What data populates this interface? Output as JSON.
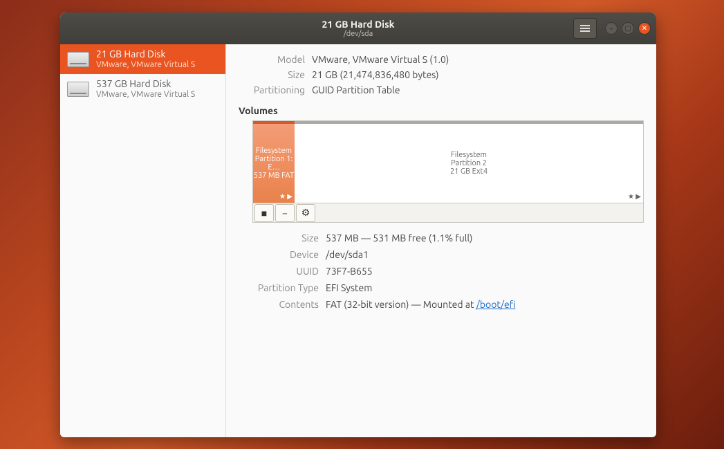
{
  "titlebar": {
    "title": "21 GB Hard Disk",
    "subtitle": "/dev/sda"
  },
  "sidebar": {
    "disks": [
      {
        "name": "21 GB Hard Disk",
        "sub": "VMware, VMware Virtual S",
        "selected": true
      },
      {
        "name": "537 GB Hard Disk",
        "sub": "VMware, VMware Virtual S",
        "selected": false
      }
    ]
  },
  "info": {
    "model_label": "Model",
    "model": "VMware, VMware Virtual S (1.0)",
    "size_label": "Size",
    "size": "21 GB (21,474,836,480 bytes)",
    "partitioning_label": "Partitioning",
    "partitioning": "GUID Partition Table"
  },
  "volumes": {
    "heading": "Volumes",
    "items": [
      {
        "line1": "Filesystem",
        "line2": "Partition 1: E…",
        "line3": "537 MB FAT"
      },
      {
        "line1": "Filesystem",
        "line2": "Partition 2",
        "line3": "21 GB Ext4"
      }
    ]
  },
  "detail": {
    "size_label": "Size",
    "size": "537 MB — 531 MB free (1.1% full)",
    "device_label": "Device",
    "device": "/dev/sda1",
    "uuid_label": "UUID",
    "uuid": "73F7-B655",
    "ptype_label": "Partition Type",
    "ptype": "EFI System",
    "contents_label": "Contents",
    "contents_prefix": "FAT (32-bit version) — Mounted at ",
    "contents_link": "/boot/efi"
  }
}
